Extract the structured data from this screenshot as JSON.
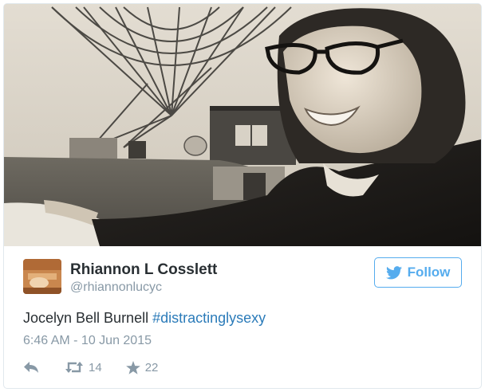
{
  "tweet": {
    "author_name": "Rhiannon L Cosslett",
    "author_handle": "@rhiannonlucyc",
    "text_plain": "Jocelyn Bell Burnell ",
    "hashtag": "#distractinglysexy",
    "timestamp": "6:46 AM - 10 Jun 2015",
    "retweet_count": "14",
    "favorite_count": "22"
  },
  "follow_button": {
    "label": "Follow",
    "icon": "twitter-bird-icon"
  },
  "action_icons": [
    "reply-icon",
    "retweet-icon",
    "star-icon"
  ],
  "colors": {
    "accent": "#55acee",
    "hashtag": "#2b7bb9",
    "muted": "#8899a6",
    "text": "#292f33"
  }
}
